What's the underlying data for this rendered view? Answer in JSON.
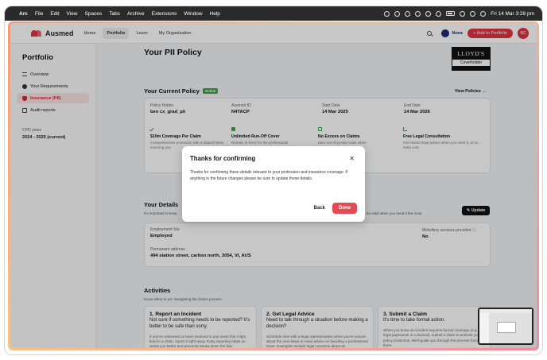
{
  "menubar": {
    "app": "Arc",
    "items": [
      "File",
      "Edit",
      "View",
      "Spaces",
      "Tabs",
      "Archive",
      "Extensions",
      "Window",
      "Help"
    ],
    "clock": "Fri 14 Mar 3:28 pm"
  },
  "topnav": {
    "brand": "Ausmed",
    "links": [
      "Home",
      "Portfolio",
      "Learn",
      "My Organisation"
    ],
    "active_link": "Portfolio",
    "org": "None",
    "add_button": "+ Add to Portfolio",
    "avatar": "BC"
  },
  "sidebar": {
    "title": "Portfolio",
    "items": [
      {
        "label": "Overview",
        "icon": "list-icon"
      },
      {
        "label": "Your Requirements",
        "icon": "dot-icon"
      },
      {
        "label": "Insurance (PII)",
        "icon": "shield-icon"
      },
      {
        "label": "Audit reports",
        "icon": "document-icon"
      }
    ],
    "active": "Insurance (PII)",
    "cpd_label": "CPD years",
    "cpd_value": "2024 - 2025 (current)"
  },
  "main": {
    "title": "Your PII Policy",
    "insurer_logo_line1": "LLOYD'S",
    "insurer_logo_line2": "Coverholder",
    "policy_section": {
      "title": "Your Current Policy",
      "badge": "Active",
      "link": "View Policies →",
      "fields": [
        {
          "label": "Policy Holder",
          "value": "ben cx_grad_pii"
        },
        {
          "label": "Ausmed ID",
          "value": "N4TACP"
        },
        {
          "label": "Start Date",
          "value": "14 Mar 2025"
        },
        {
          "label": "End Date",
          "value": "14 Mar 2026"
        }
      ],
      "features": [
        {
          "title": "$10m Coverage Per Claim",
          "desc": "Comprehensive protection with a shared limits, ensuring you",
          "icon": "check-icon"
        },
        {
          "title": "Unlimited Run-Off Cover",
          "desc": "Remain in-force for the professional",
          "icon": "file-check-icon"
        },
        {
          "title": "No Excess on Claims",
          "desc": "Zero out-of-pocket costs when",
          "icon": "money-icon"
        },
        {
          "title": "Free Legal Consultation",
          "desc": "Get instant legal advice when you need it, at no extra cost.",
          "icon": "scale-icon"
        }
      ]
    },
    "details_section": {
      "title": "Your Details",
      "sub": "It's important to keep",
      "sub_right": "be valid when you need it the most.",
      "update_button": "Update",
      "employment_label": "Employment Sta",
      "employment_value": "Employed",
      "midwifery_label": "Midwifery services provided",
      "midwifery_value": "No",
      "address_label": "Permanent address",
      "address_value": "494 station street, carlton north, 3054, VI, AUS"
    },
    "activities": {
      "title": "Activities",
      "sub": "Know when to act. Navigating the claims process.",
      "cards": [
        {
          "title": "1. Report an Incident",
          "q": "Not sure if something needs to be reported? It's better to be safe than sorry.",
          "body": "If you've witnessed or been involved in any event that might lead to a claim, report it right away. Early reporting helps us assist you better and prevents issues down the line."
        },
        {
          "title": "2. Get Legal Advice",
          "q": "Need to talk through a situation before making a decision?",
          "body": "Schedule time with a legal representative when you're unsure about the next steps or need advice on handling a professional issue. Examples include legal concerns about an"
        },
        {
          "title": "3. Submit a Claim",
          "q": "It's time to take formal action.",
          "body": "When you know an incident requires formal coverage (e.g., legal paperwork or a lawsuit), submit a claim to activate your policy protection. We'll guide you through the process from there."
        }
      ]
    }
  },
  "modal": {
    "title": "Thanks for confirming",
    "text": "Thanks for confirming these details relevant to your profession and insurance coverage. If anything in the future changes please be sure to update these details.",
    "back": "Back",
    "done": "Done"
  }
}
